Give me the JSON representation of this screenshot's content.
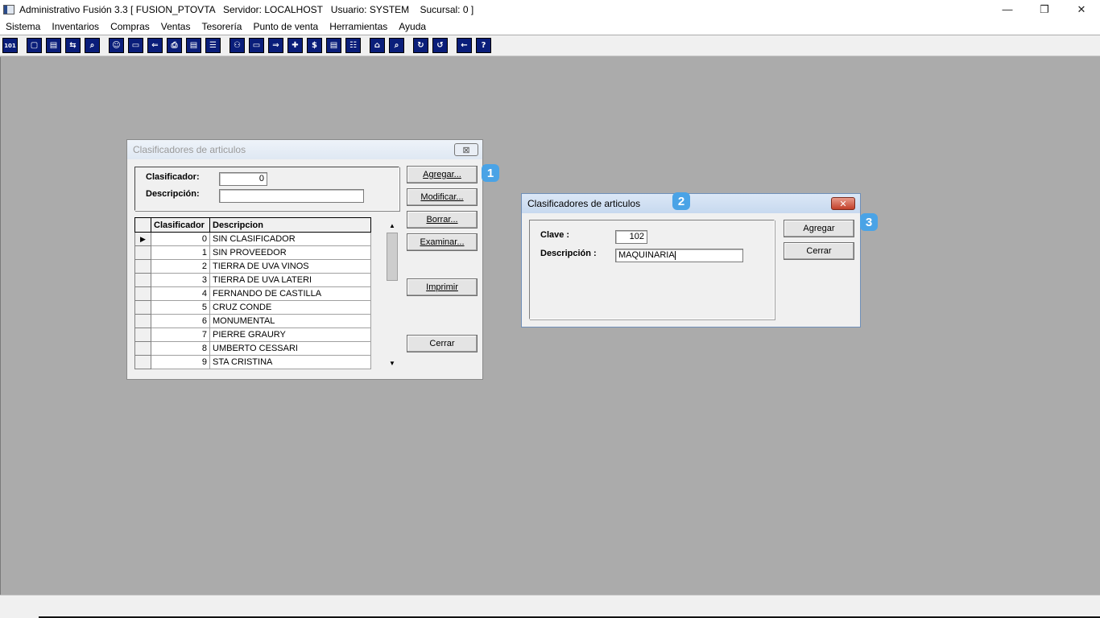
{
  "app": {
    "title": "Administrativo Fusión 3.3 [ FUSION_PTOVTA   Servidor: LOCALHOST   Usuario: SYSTEM    Sucursal: 0 ]",
    "minimize": "—",
    "restore": "❐",
    "close": "✕"
  },
  "menu": [
    "Sistema",
    "Inventarios",
    "Compras",
    "Ventas",
    "Tesorería",
    "Punto de venta",
    "Herramientas",
    "Ayuda"
  ],
  "toolbar": [
    "calculator-icon",
    "copy-icon",
    "clipboard-icon",
    "transfer-icon",
    "search-icon",
    "user-icon",
    "card-icon",
    "export-icon",
    "print-icon",
    "document-icon",
    "list-icon",
    "binoculars-icon",
    "box-icon",
    "move-icon",
    "add-icon",
    "dollar-icon",
    "report-icon",
    "table-icon",
    "home-icon",
    "zoom-icon",
    "refresh-icon",
    "undo-icon",
    "back-icon",
    "help-icon"
  ],
  "toolbar_glyphs": [
    "101",
    "▢",
    "▤",
    "⇆",
    "⌕",
    "☺",
    "▭",
    "⇐",
    "⎙",
    "▤",
    "☰",
    "⚇",
    "▭",
    "⇒",
    "✚",
    "$",
    "▤",
    "☷",
    "⌂",
    "⌕",
    "↻",
    "↺",
    "←",
    "?"
  ],
  "list_window": {
    "title": "Clasificadores de articulos",
    "close": "⊠",
    "clasificador_label": "Clasificador:",
    "clasificador_value": "0",
    "descripcion_label": "Descripción:",
    "descripcion_value": "",
    "buttons": {
      "agregar": "Agregar...",
      "modificar": "Modificar...",
      "borrar": "Borrar...",
      "examinar": "Examinar...",
      "imprimir": "Imprimir",
      "cerrar": "Cerrar"
    },
    "columns": [
      "Clasificador",
      "Descripcion"
    ],
    "rows": [
      {
        "id": "0",
        "desc": "SIN CLASIFICADOR"
      },
      {
        "id": "1",
        "desc": "SIN PROVEEDOR"
      },
      {
        "id": "2",
        "desc": "TIERRA DE UVA VINOS"
      },
      {
        "id": "3",
        "desc": "TIERRA DE UVA LATERI"
      },
      {
        "id": "4",
        "desc": "FERNANDO DE CASTILLA"
      },
      {
        "id": "5",
        "desc": "CRUZ CONDE"
      },
      {
        "id": "6",
        "desc": "MONUMENTAL"
      },
      {
        "id": "7",
        "desc": "PIERRE GRAURY"
      },
      {
        "id": "8",
        "desc": "UMBERTO CESSARI"
      },
      {
        "id": "9",
        "desc": "STA CRISTINA"
      }
    ],
    "selected_marker": "▶"
  },
  "add_dialog": {
    "title": "Clasificadores de articulos",
    "close": "✕",
    "clave_label": "Clave :",
    "clave_value": "102",
    "descripcion_label": "Descripción :",
    "descripcion_value": "MAQUINARIA",
    "agregar": "Agregar",
    "cerrar": "Cerrar"
  },
  "badges": [
    "1",
    "2",
    "3"
  ]
}
